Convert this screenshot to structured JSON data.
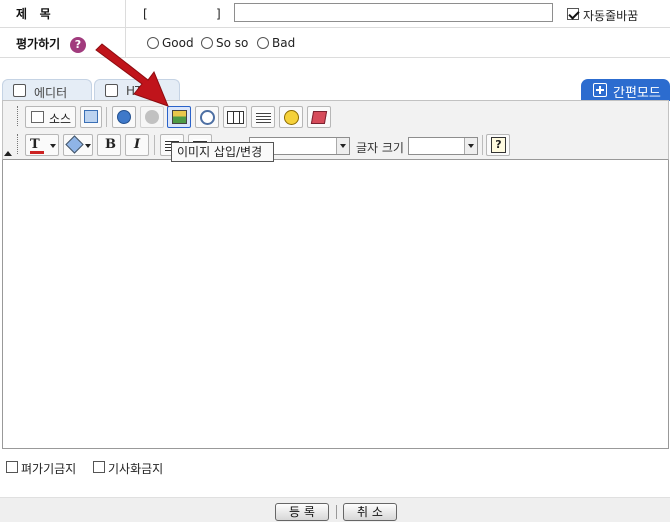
{
  "form": {
    "title_label": "제   목",
    "title_bracket_open": "[",
    "title_bracket_close": "]",
    "title_value": "",
    "autowrap_label": "자동줄바꿈",
    "autowrap_checked": true,
    "rating_label": "평가하기",
    "rating_help_glyph": "?",
    "rating_options": [
      "Good",
      "So so",
      "Bad"
    ]
  },
  "tabs": {
    "editor_label": "에디터",
    "second_label": "HTML",
    "quick_mode_label": "간편모드"
  },
  "toolbar": {
    "source_label": "소스",
    "font_size_label": "글자 크기",
    "help_glyph": "?",
    "bold_glyph": "B",
    "italic_glyph": "I",
    "tooltip_text": "이미지 삽입/변경"
  },
  "options": {
    "no_rating_label": "펴가기금지",
    "no_article_label": "기사화금지"
  },
  "buttons": {
    "submit_label": "등 록",
    "cancel_label": "취 소"
  },
  "colors": {
    "accent": "#2c6ccf",
    "arrow": "#c0141b",
    "help_icon": "#a13b7d"
  }
}
